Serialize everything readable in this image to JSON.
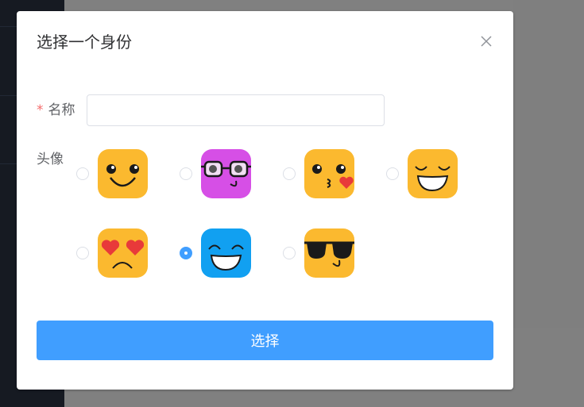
{
  "dialog": {
    "title": "选择一个身份",
    "close_icon": "close-icon"
  },
  "form": {
    "name_label": "名称",
    "required_mark": "*",
    "name_value": "",
    "name_placeholder": "",
    "avatar_label": "头像"
  },
  "avatars": [
    {
      "name": "smile-face-icon",
      "selected": false
    },
    {
      "name": "nerd-glasses-face-icon",
      "selected": false
    },
    {
      "name": "kiss-heart-face-icon",
      "selected": false
    },
    {
      "name": "grin-face-icon",
      "selected": false
    },
    {
      "name": "heart-eyes-sad-face-icon",
      "selected": false
    },
    {
      "name": "happy-blue-face-icon",
      "selected": true
    },
    {
      "name": "sunglasses-face-icon",
      "selected": false
    }
  ],
  "actions": {
    "select_label": "选择"
  },
  "colors": {
    "primary": "#409eff",
    "required": "#f56c6c",
    "face_yellow": "#fbb92f",
    "face_purple": "#d64fe6",
    "face_blue": "#11a0f1"
  }
}
